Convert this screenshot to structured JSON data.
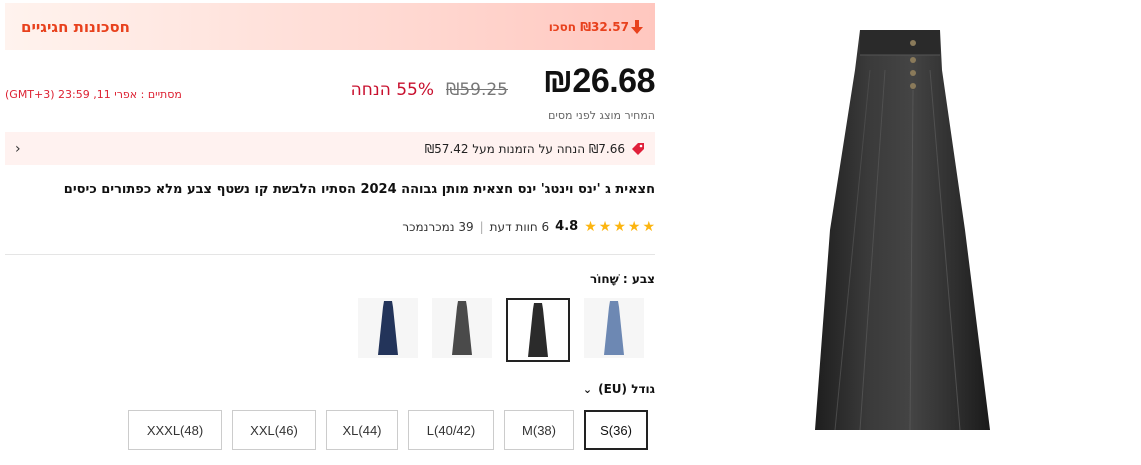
{
  "promo": {
    "title": "חסכונות חגיגיים",
    "save": "₪32.57 חסכו"
  },
  "price": {
    "current": "₪26.68",
    "original": "₪59.25",
    "discount": "55% הנחה",
    "ends": "מסתיים : אפרי 11, 23:59 (GMT+3)",
    "tax_note": "המחיר מוצג לפני מסים"
  },
  "coupon": {
    "text": "₪7.66 הנחה על הזמנות מעל ₪57.42"
  },
  "product": {
    "title": "חצאית ג 'ינס וינטג' ינס חצאית מותן גבוהה 2024 הסתיו הלבשת קו נשטף צבע מלא כפתורים כיסים"
  },
  "ratings": {
    "value": "4.8",
    "reviews": "6 חוות דעת",
    "sold": "39 נמכרנמכר",
    "stars": 5
  },
  "color": {
    "label": "צבע : שָׁחוֹר",
    "options": [
      "light-blue",
      "black",
      "gray",
      "dark-blue"
    ],
    "selected": 1
  },
  "size": {
    "label": "גודל (EU)",
    "options": [
      "S(36)",
      "M(38)",
      "L(40/42)",
      "XL(44)",
      "XXL(46)",
      "XXXL(48)"
    ],
    "selected": 0
  },
  "colors": {
    "accent": "#e8411d",
    "price_red": "#c8102e",
    "star": "#fcb510"
  }
}
